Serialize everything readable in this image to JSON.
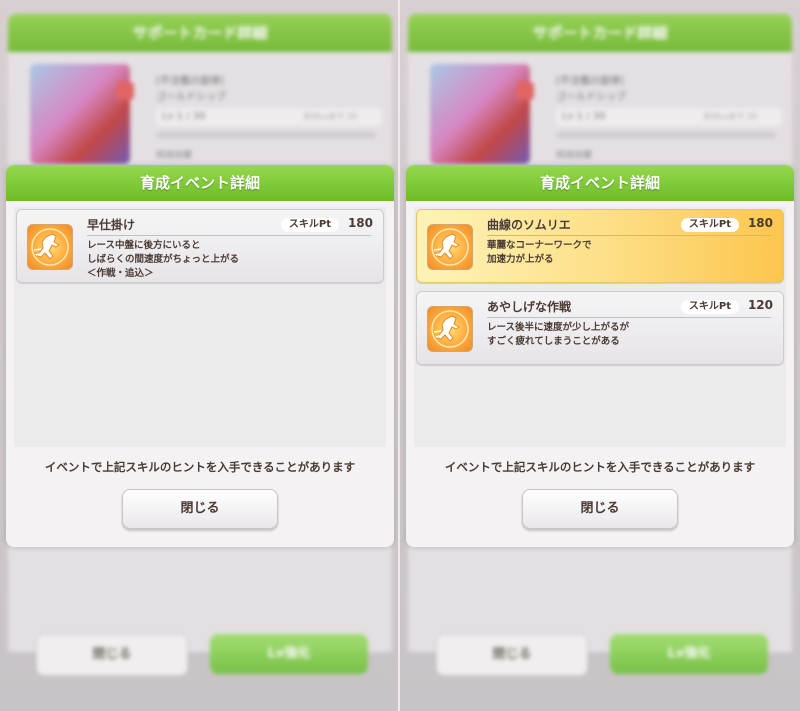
{
  "panels": [
    {
      "background": {
        "window_title": "サポートカード詳細",
        "card_title": "[不沈艦の旋律]",
        "card_name": "ゴールドシップ",
        "level": "Lv 1 / 30",
        "level_note": "次のLvまで 15",
        "effects_label": "所持効果",
        "footer_close_label": "閉じる",
        "footer_lvup_label": "Lv強化"
      },
      "modal": {
        "title": "育成イベント詳細",
        "events": [
          {
            "name": "早仕掛け",
            "skill_label": "スキルPt",
            "skill_pt": "180",
            "desc": [
              "レース中盤に後方にいると",
              "しばらくの間速度がちょっと上がる",
              "＜作戦・追込＞"
            ],
            "rarity": "normal",
            "icon": "speed-runner-icon"
          }
        ],
        "note": "イベントで上記スキルのヒントを入手できることがあります",
        "close_label": "閉じる"
      }
    },
    {
      "background": {
        "window_title": "サポートカード詳細",
        "card_title": "[不沈艦の旋律]",
        "card_name": "ゴールドシップ",
        "level": "Lv 1 / 30",
        "level_note": "次のLvまで 15",
        "effects_label": "所持効果",
        "footer_close_label": "閉じる",
        "footer_lvup_label": "Lv強化"
      },
      "modal": {
        "title": "育成イベント詳細",
        "events": [
          {
            "name": "曲線のソムリエ",
            "skill_label": "スキルPt",
            "skill_pt": "180",
            "desc": [
              "華麗なコーナーワークで",
              "加速力が上がる"
            ],
            "rarity": "gold",
            "icon": "speed-runner-icon"
          },
          {
            "name": "あやしげな作戦",
            "skill_label": "スキルPt",
            "skill_pt": "120",
            "desc": [
              "レース後半に速度が少し上がるが",
              "すごく疲れてしまうことがある"
            ],
            "rarity": "normal",
            "icon": "speed-runner-icon"
          }
        ],
        "note": "イベントで上記スキルのヒントを入手できることがあります",
        "close_label": "閉じる"
      }
    }
  ],
  "colors": {
    "header_green": "#7cc83a",
    "text_brown": "#4a3b34",
    "gold_event": "#fcc64e"
  }
}
